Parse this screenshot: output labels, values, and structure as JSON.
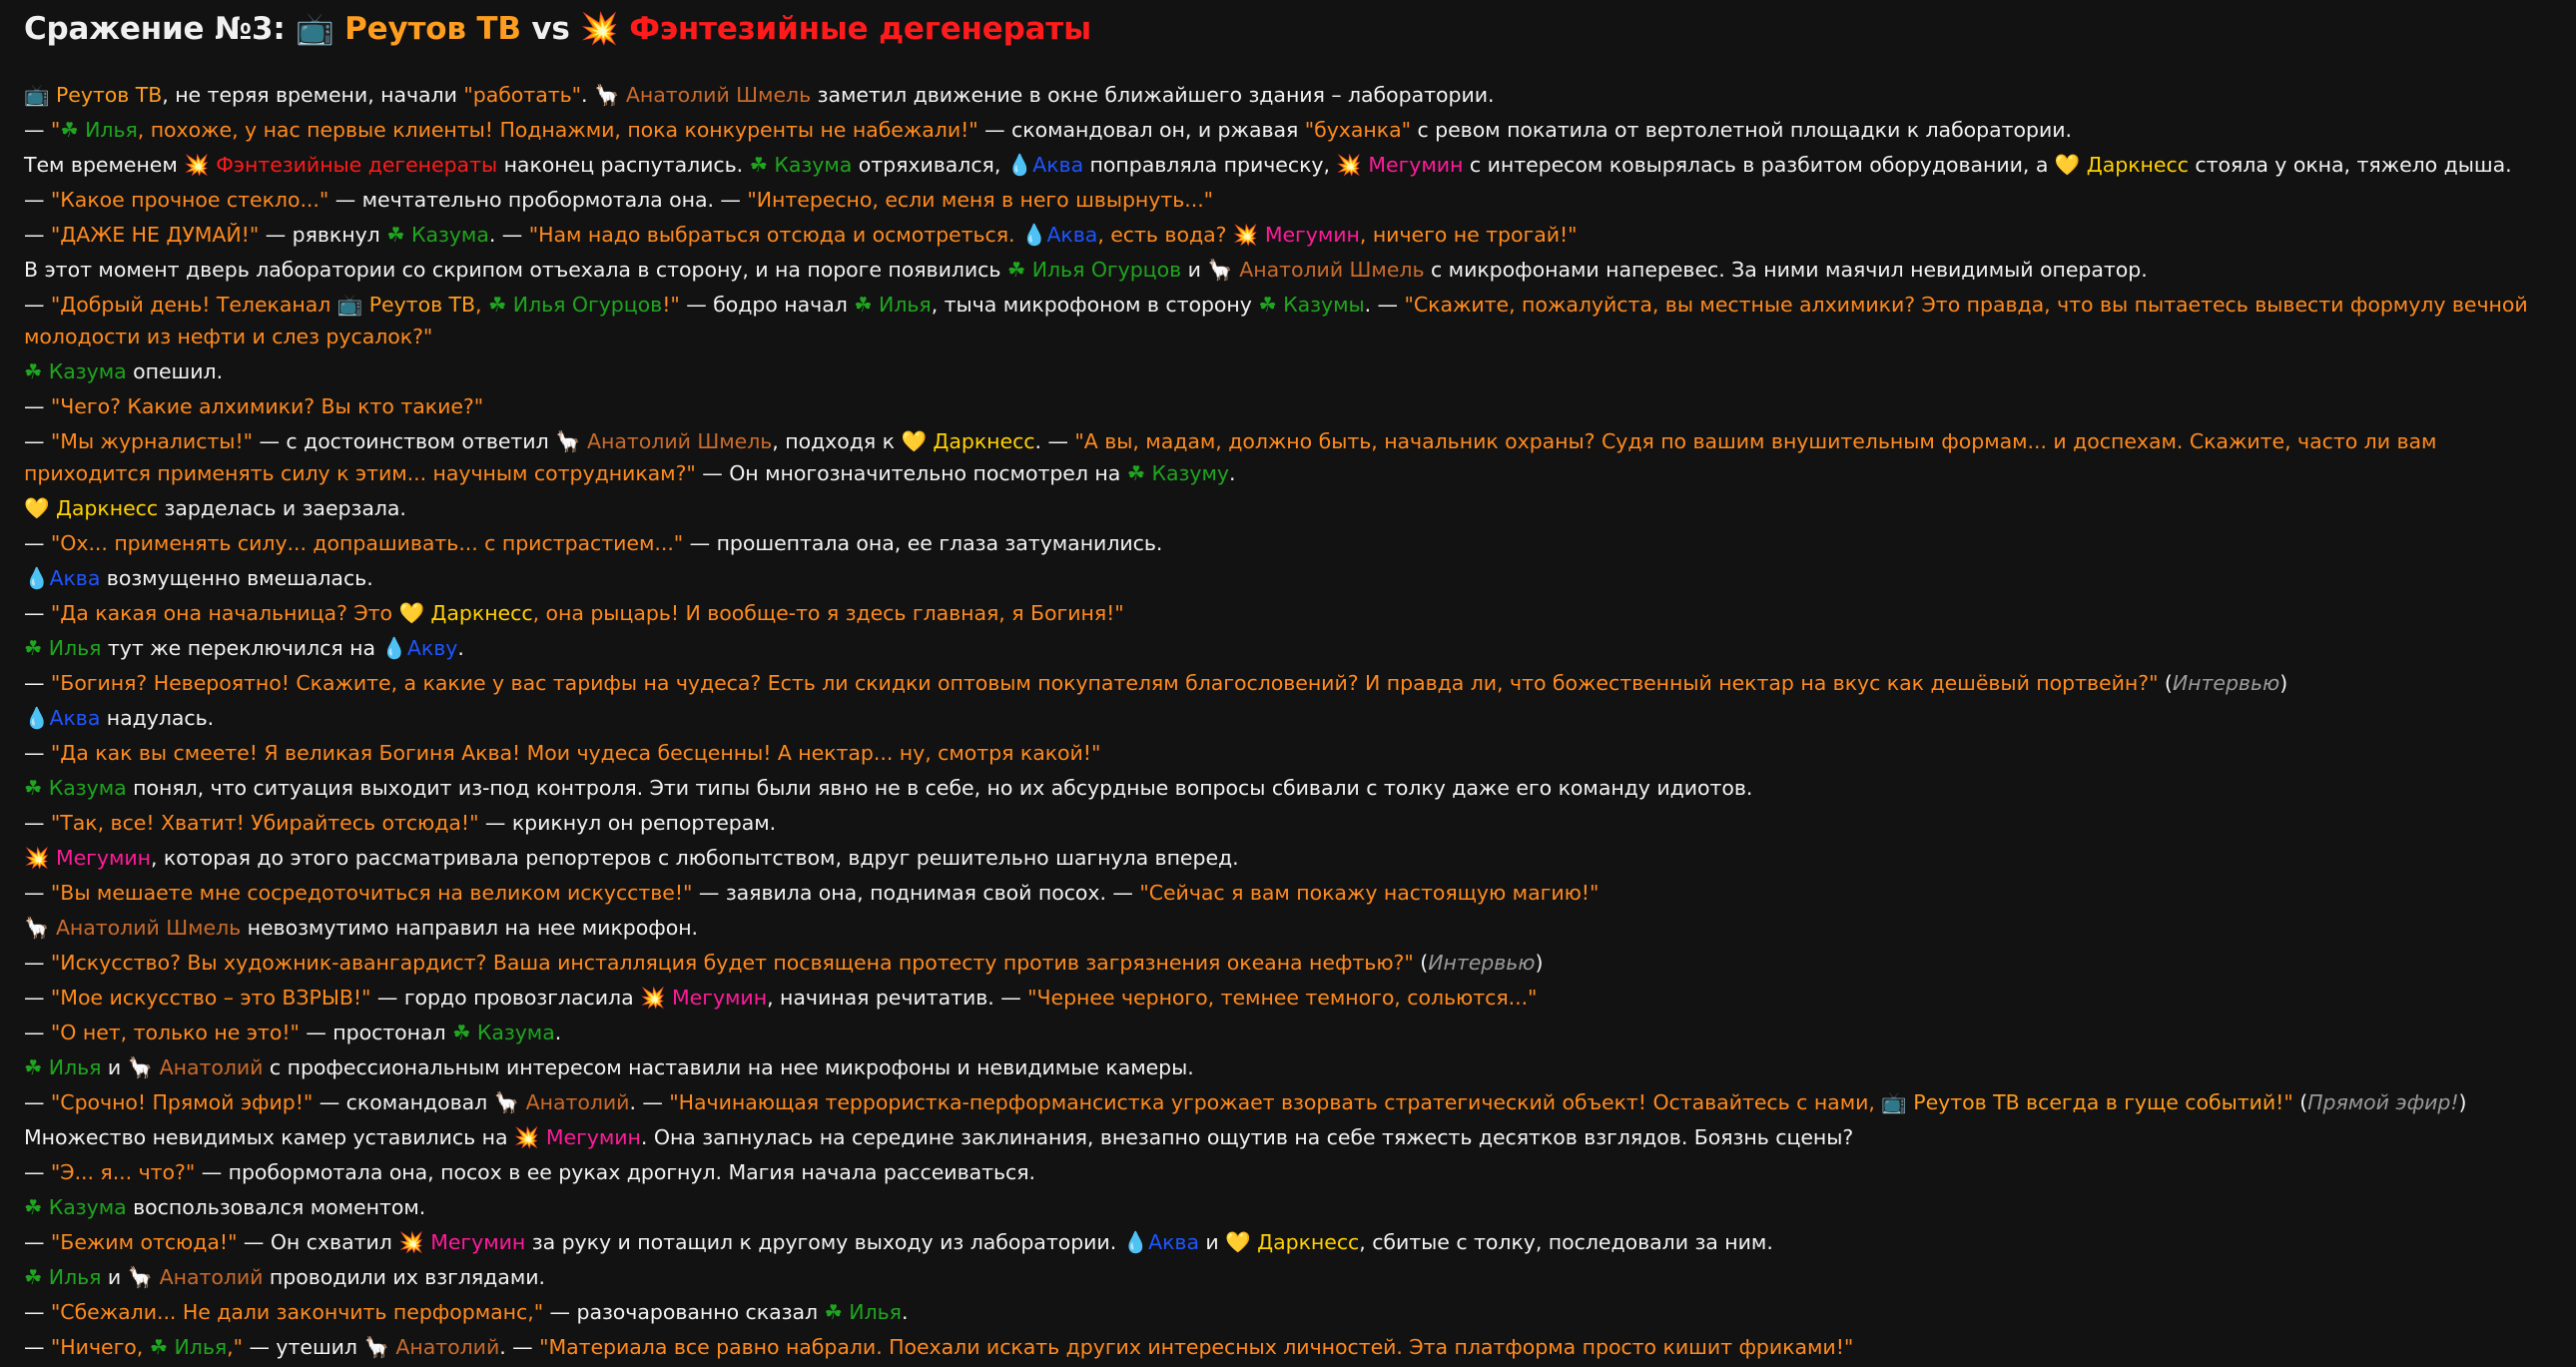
{
  "title": {
    "prefix": "Сражение №3: ",
    "team1_icon": "📺",
    "team1": "Реутов ТВ",
    "vs": " vs ",
    "team2_icon": "💥",
    "team2": "Фэнтезийные дегенераты"
  },
  "colors": {
    "background": "#121212",
    "text": "#f2f2f2",
    "quote": "#ff8a1e",
    "reutov": "#ff9d1e",
    "anatoly": "#c96b2c",
    "ilya": "#1fa51f",
    "kazuma": "#1fa51f",
    "akva": "#1e55ff",
    "megumin": "#ff1b9a",
    "darkness": "#ffd200",
    "fantasy": "#ff1b1b",
    "aside": "#9a9a9a"
  },
  "lines": [
    [
      [
        "c-reutov",
        "📺 Реутов ТВ"
      ],
      [
        "t",
        ", не теряя времени, начали "
      ],
      [
        "q",
        "\"работать\""
      ],
      [
        "t",
        ". "
      ],
      [
        "c-anatoly",
        "🦙 Анатолий Шмель"
      ],
      [
        "t",
        " заметил движение в окне ближайшего здания – лаборатории."
      ]
    ],
    [
      [
        "t",
        "— "
      ],
      [
        "q",
        "\""
      ],
      [
        "c-ilya",
        "☘ Илья"
      ],
      [
        "q",
        ", похоже, у нас первые клиенты! Поднажми, пока конкуренты не набежали!\""
      ],
      [
        "t",
        " — скомандовал он, и ржавая "
      ],
      [
        "q",
        "\"буханка\""
      ],
      [
        "t",
        " с ревом покатила от вертолетной площадки к лаборатории."
      ]
    ],
    [
      [
        "t",
        "Тем временем "
      ],
      [
        "c-fant",
        "💥 Фэнтезийные дегенераты"
      ],
      [
        "t",
        " наконец распутались. "
      ],
      [
        "c-kazuma",
        "☘ Казума"
      ],
      [
        "t",
        " отряхивался, "
      ],
      [
        "c-akva",
        "💧Аква"
      ],
      [
        "t",
        " поправляла прическу, "
      ],
      [
        "c-megumin",
        "💥 Мегумин"
      ],
      [
        "t",
        " с интересом ковырялась в разбитом оборудовании, а "
      ],
      [
        "c-darkness",
        "💛 Даркнесс"
      ],
      [
        "t",
        " стояла у окна, тяжело дыша."
      ]
    ],
    [
      [
        "t",
        "— "
      ],
      [
        "q",
        "\"Какое прочное стекло...\""
      ],
      [
        "t",
        " — мечтательно пробормотала она. — "
      ],
      [
        "q",
        "\"Интересно, если меня в него швырнуть...\""
      ]
    ],
    [
      [
        "t",
        "— "
      ],
      [
        "q",
        "\"ДАЖЕ НЕ ДУМАЙ!\""
      ],
      [
        "t",
        " — рявкнул "
      ],
      [
        "c-kazuma",
        "☘ Казума"
      ],
      [
        "t",
        ". — "
      ],
      [
        "q",
        "\"Нам надо выбраться отсюда и осмотреться. "
      ],
      [
        "c-akva",
        "💧Аква"
      ],
      [
        "q",
        ", есть вода? "
      ],
      [
        "c-megumin",
        "💥 Мегумин"
      ],
      [
        "q",
        ", ничего не трогай!\""
      ]
    ],
    [
      [
        "t",
        "В этот момент дверь лаборатории со скрипом отъехала в сторону, и на пороге появились "
      ],
      [
        "c-ilya",
        "☘ Илья Огурцов"
      ],
      [
        "t",
        " и "
      ],
      [
        "c-anatoly",
        "🦙 Анатолий Шмель"
      ],
      [
        "t",
        " с микрофонами наперевес. За ними маячил невидимый оператор."
      ]
    ],
    [
      [
        "t",
        "— "
      ],
      [
        "q",
        "\"Добрый день! Телеканал "
      ],
      [
        "c-reutov",
        "📺 Реутов ТВ"
      ],
      [
        "q",
        ", "
      ],
      [
        "c-ilya",
        "☘ Илья Огурцов"
      ],
      [
        "q",
        "!\""
      ],
      [
        "t",
        " — бодро начал "
      ],
      [
        "c-ilya",
        "☘ Илья"
      ],
      [
        "t",
        ", тыча микрофоном в сторону "
      ],
      [
        "c-kazuma",
        "☘ Казумы"
      ],
      [
        "t",
        ". — "
      ],
      [
        "q",
        "\"Скажите, пожалуйста, вы местные алхимики? Это правда, что вы пытаетесь вывести формулу вечной молодости из нефти и слез русалок?\""
      ]
    ],
    [
      [
        "c-kazuma",
        "☘ Казума"
      ],
      [
        "t",
        " опешил."
      ]
    ],
    [
      [
        "t",
        "— "
      ],
      [
        "q",
        "\"Чего? Какие алхимики? Вы кто такие?\""
      ]
    ],
    [
      [
        "t",
        "— "
      ],
      [
        "q",
        "\"Мы журналисты!\""
      ],
      [
        "t",
        " — с достоинством ответил "
      ],
      [
        "c-anatoly",
        "🦙 Анатолий Шмель"
      ],
      [
        "t",
        ", подходя к "
      ],
      [
        "c-darkness",
        "💛 Даркнесс"
      ],
      [
        "t",
        ". — "
      ],
      [
        "q",
        "\"А вы, мадам, должно быть, начальник охраны? Судя по вашим внушительным формам... и доспехам. Скажите, часто ли вам приходится применять силу к этим... научным сотрудникам?\""
      ],
      [
        "t",
        " — Он многозначительно посмотрел на "
      ],
      [
        "c-kazuma",
        "☘ Казуму"
      ],
      [
        "t",
        "."
      ]
    ],
    [
      [
        "c-darkness",
        "💛 Даркнесс"
      ],
      [
        "t",
        " зарделась и заерзала."
      ]
    ],
    [
      [
        "t",
        "— "
      ],
      [
        "q",
        "\"Ох... применять силу... допрашивать... с пристрастием...\""
      ],
      [
        "t",
        " — прошептала она, ее глаза затуманились."
      ]
    ],
    [
      [
        "c-akva",
        "💧Аква"
      ],
      [
        "t",
        " возмущенно вмешалась."
      ]
    ],
    [
      [
        "t",
        "— "
      ],
      [
        "q",
        "\"Да какая она начальница? Это "
      ],
      [
        "c-darkness",
        "💛 Даркнесс"
      ],
      [
        "q",
        ", она рыцарь! И вообще-то я здесь главная, я Богиня!\""
      ]
    ],
    [
      [
        "c-ilya",
        "☘ Илья"
      ],
      [
        "t",
        " тут же переключился на "
      ],
      [
        "c-akva",
        "💧Акву"
      ],
      [
        "t",
        "."
      ]
    ],
    [
      [
        "t",
        "— "
      ],
      [
        "q",
        "\"Богиня? Невероятно! Скажите, а какие у вас тарифы на чудеса? Есть ли скидки оптовым покупателям благословений? И правда ли, что божественный нектар на вкус как дешёвый портвейн?\""
      ],
      [
        "t",
        " ("
      ],
      [
        "aside",
        "Интервью"
      ],
      [
        "t",
        ")"
      ]
    ],
    [
      [
        "c-akva",
        "💧Аква"
      ],
      [
        "t",
        " надулась."
      ]
    ],
    [
      [
        "t",
        "— "
      ],
      [
        "q",
        "\"Да как вы смеете! Я великая Богиня Аква! Мои чудеса бесценны! А нектар... ну, смотря какой!\""
      ]
    ],
    [
      [
        "c-kazuma",
        "☘ Казума"
      ],
      [
        "t",
        " понял, что ситуация выходит из-под контроля. Эти типы были явно не в себе, но их абсурдные вопросы сбивали с толку даже его команду идиотов."
      ]
    ],
    [
      [
        "t",
        "— "
      ],
      [
        "q",
        "\"Так, все! Хватит! Убирайтесь отсюда!\""
      ],
      [
        "t",
        " — крикнул он репортерам."
      ]
    ],
    [
      [
        "c-megumin",
        "💥 Мегумин"
      ],
      [
        "t",
        ", которая до этого рассматривала репортеров с любопытством, вдруг решительно шагнула вперед."
      ]
    ],
    [
      [
        "t",
        "— "
      ],
      [
        "q",
        "\"Вы мешаете мне сосредоточиться на великом искусстве!\""
      ],
      [
        "t",
        " — заявила она, поднимая свой посох. — "
      ],
      [
        "q",
        "\"Сейчас я вам покажу настоящую магию!\""
      ]
    ],
    [
      [
        "c-anatoly",
        "🦙 Анатолий Шмель"
      ],
      [
        "t",
        " невозмутимо направил на нее микрофон."
      ]
    ],
    [
      [
        "t",
        "— "
      ],
      [
        "q",
        "\"Искусство? Вы художник-авангардист? Ваша инсталляция будет посвящена протесту против загрязнения океана нефтью?\""
      ],
      [
        "t",
        " ("
      ],
      [
        "aside",
        "Интервью"
      ],
      [
        "t",
        ")"
      ]
    ],
    [
      [
        "t",
        "— "
      ],
      [
        "q",
        "\"Мое искусство – это ВЗРЫВ!\""
      ],
      [
        "t",
        " — гордо провозгласила "
      ],
      [
        "c-megumin",
        "💥 Мегумин"
      ],
      [
        "t",
        ", начиная речитатив. — "
      ],
      [
        "q",
        "\"Чернее черного, темнее темного, сольются...\""
      ]
    ],
    [
      [
        "t",
        "— "
      ],
      [
        "q",
        "\"О нет, только не это!\""
      ],
      [
        "t",
        " — простонал "
      ],
      [
        "c-kazuma",
        "☘ Казума"
      ],
      [
        "t",
        "."
      ]
    ],
    [
      [
        "c-ilya",
        "☘ Илья"
      ],
      [
        "t",
        " и "
      ],
      [
        "c-anatoly",
        "🦙 Анатолий"
      ],
      [
        "t",
        " с профессиональным интересом наставили на нее микрофоны и невидимые камеры."
      ]
    ],
    [
      [
        "t",
        "— "
      ],
      [
        "q",
        "\"Срочно! Прямой эфир!\""
      ],
      [
        "t",
        " — скомандовал "
      ],
      [
        "c-anatoly",
        "🦙 Анатолий"
      ],
      [
        "t",
        ". — "
      ],
      [
        "q",
        "\"Начинающая террористка-перформансистка угрожает взорвать стратегический объект! Оставайтесь с нами, "
      ],
      [
        "c-reutov",
        "📺 Реутов ТВ всегда в гуще событий!"
      ],
      [
        "q",
        "\""
      ],
      [
        "t",
        " ("
      ],
      [
        "aside",
        "Прямой эфир!"
      ],
      [
        "t",
        ")"
      ]
    ],
    [
      [
        "t",
        "Множество невидимых камер уставились на "
      ],
      [
        "c-megumin",
        "💥 Мегумин"
      ],
      [
        "t",
        ". Она запнулась на середине заклинания, внезапно ощутив на себе тяжесть десятков взглядов. Боязнь сцены?"
      ]
    ],
    [
      [
        "t",
        "— "
      ],
      [
        "q",
        "\"Э... я... что?\""
      ],
      [
        "t",
        " — пробормотала она, посох в ее руках дрогнул. Магия начала рассеиваться."
      ]
    ],
    [
      [
        "c-kazuma",
        "☘ Казума"
      ],
      [
        "t",
        " воспользовался моментом."
      ]
    ],
    [
      [
        "t",
        "— "
      ],
      [
        "q",
        "\"Бежим отсюда!\""
      ],
      [
        "t",
        " — Он схватил "
      ],
      [
        "c-megumin",
        "💥 Мегумин"
      ],
      [
        "t",
        " за руку и потащил к другому выходу из лаборатории. "
      ],
      [
        "c-akva",
        "💧Аква"
      ],
      [
        "t",
        " и "
      ],
      [
        "c-darkness",
        "💛 Даркнесс"
      ],
      [
        "t",
        ", сбитые с толку, последовали за ним."
      ]
    ],
    [
      [
        "c-ilya",
        "☘ Илья"
      ],
      [
        "t",
        " и "
      ],
      [
        "c-anatoly",
        "🦙 Анатолий"
      ],
      [
        "t",
        " проводили их взглядами."
      ]
    ],
    [
      [
        "t",
        "— "
      ],
      [
        "q",
        "\"Сбежали... Не дали закончить перформанс,\""
      ],
      [
        "t",
        " — разочарованно сказал "
      ],
      [
        "c-ilya",
        "☘ Илья"
      ],
      [
        "t",
        "."
      ]
    ],
    [
      [
        "t",
        "— "
      ],
      [
        "q",
        "\"Ничего, "
      ],
      [
        "c-ilya",
        "☘ Илья"
      ],
      [
        "q",
        ",\""
      ],
      [
        "t",
        " — утешил "
      ],
      [
        "c-anatoly",
        "🦙 Анатолий"
      ],
      [
        "t",
        ". — "
      ],
      [
        "q",
        "\"Материала все равно набрали. Поехали искать других интересных личностей. Эта платформа просто кишит фриками!\""
      ]
    ]
  ]
}
